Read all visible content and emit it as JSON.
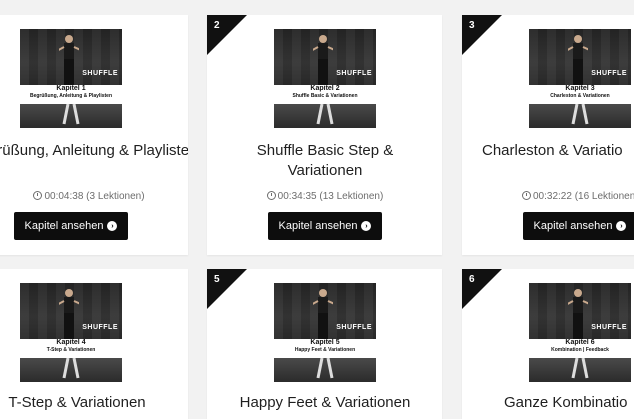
{
  "chapters": [
    {
      "number": "",
      "thumb_title": "Kapitel 1",
      "thumb_subtitle": "Begrüßung, Anleitung & Playlisten",
      "title": "egrüßung, Anleitung & Playlisten",
      "meta": "00:04:38 (3 Lektionen)",
      "button": "Kapitel ansehen"
    },
    {
      "number": "2",
      "thumb_title": "Kapitel 2",
      "thumb_subtitle": "Shuffle Basic & Variationen",
      "title": "Shuffle Basic Step & Variationen",
      "meta": "00:34:35 (13 Lektionen)",
      "button": "Kapitel ansehen"
    },
    {
      "number": "3",
      "thumb_title": "Kapitel 3",
      "thumb_subtitle": "Charleston & Variationen",
      "title": "Charleston & Variatio",
      "meta": "00:32:22 (16 Lektionen",
      "button": "Kapitel ansehen"
    },
    {
      "number": "",
      "thumb_title": "Kapitel 4",
      "thumb_subtitle": "T-Step & Variationen",
      "title": "T-Step & Variationen",
      "meta": "",
      "button": ""
    },
    {
      "number": "5",
      "thumb_title": "Kapitel 5",
      "thumb_subtitle": "Happy Feet & Variationen",
      "title": "Happy Feet & Variationen",
      "meta": "",
      "button": ""
    },
    {
      "number": "6",
      "thumb_title": "Kapitel 6",
      "thumb_subtitle": "Kombination | Feedback",
      "title": "Ganze Kombinatio",
      "meta": "",
      "button": ""
    }
  ],
  "brand": "SHUFFLE",
  "icons": {
    "clock": "clock-icon",
    "arrow": "chevron-circle-right-icon"
  },
  "colors": {
    "button": "#0d0d0d",
    "corner": "#111111",
    "background": "#f2f2f2"
  }
}
